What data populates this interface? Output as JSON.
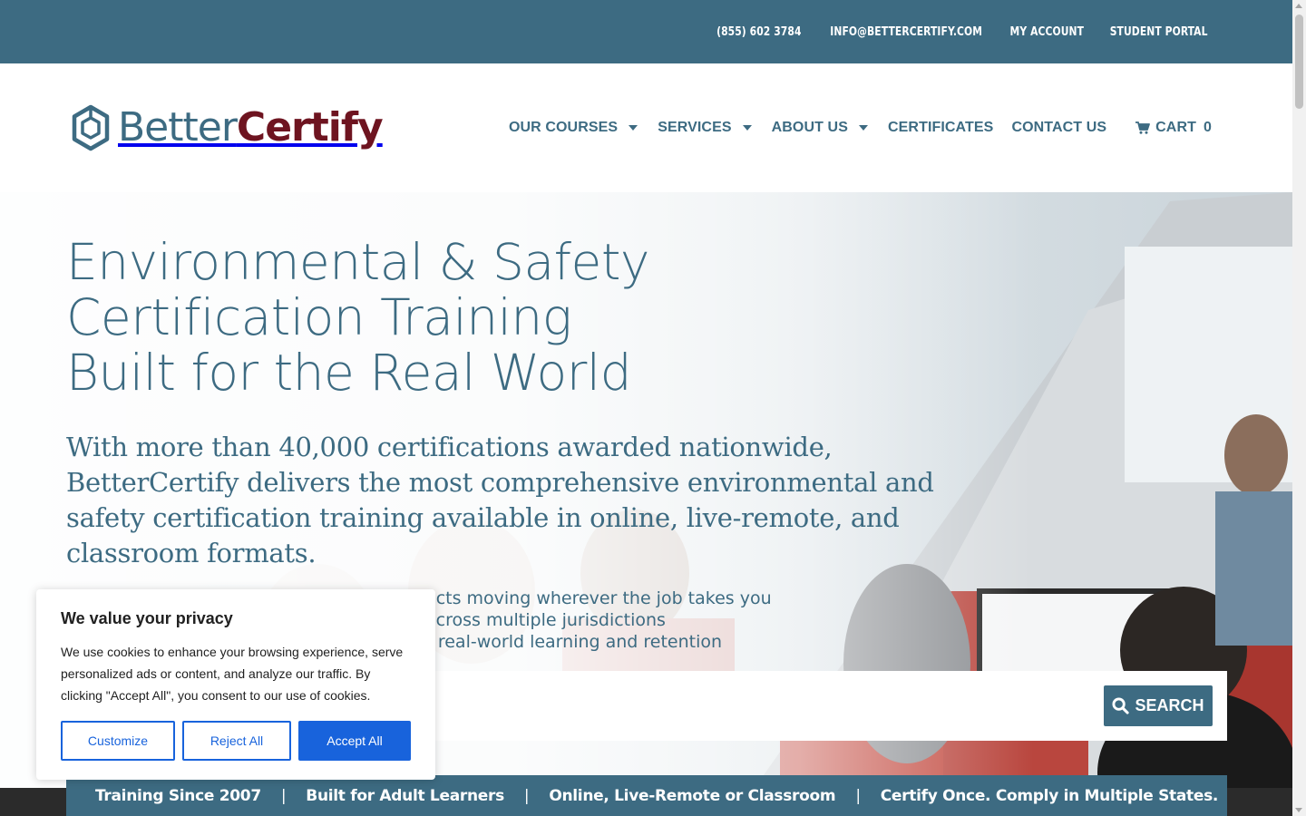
{
  "topbar": {
    "phone": "(855) 602 3784",
    "email": "INFO@BETTERCERTIFY.COM",
    "account": "MY ACCOUNT",
    "portal": "STUDENT PORTAL"
  },
  "brand": {
    "name_part1": "Better",
    "name_part2": "Certify",
    "logo_icon": "hexagon-logo-icon"
  },
  "nav": {
    "items": [
      {
        "label": "OUR COURSES",
        "has_dropdown": true
      },
      {
        "label": "SERVICES",
        "has_dropdown": true
      },
      {
        "label": "ABOUT US",
        "has_dropdown": true
      },
      {
        "label": "CERTIFICATES",
        "has_dropdown": false
      },
      {
        "label": "CONTACT US",
        "has_dropdown": false
      }
    ],
    "cart_label": "CART",
    "cart_count": "0",
    "cart_icon": "shopping-cart-icon"
  },
  "hero": {
    "title_lines": [
      "Environmental & Safety",
      "Certification Training",
      "Built for the Real World"
    ],
    "subtitle": "With more than 40,000 certifications awarded nationwide, BetterCertify delivers the most comprehensive environmental and safety certification training available in online, live-remote, and classroom formats.",
    "bullets": [
      "ects moving wherever the job takes you",
      "across multiple jurisdictions",
      "r real-world learning and retention"
    ]
  },
  "search": {
    "placeholder": "",
    "button_label": "SEARCH",
    "icon": "search-icon"
  },
  "features": {
    "items": [
      "Training Since 2007",
      "Built for Adult Learners",
      "Online, Live-Remote or Classroom",
      "Certify Once. Comply in Multiple States."
    ],
    "separator": "|"
  },
  "cookie": {
    "title": "We value your privacy",
    "text": "We use cookies to enhance your browsing experience, serve personalized ads or content, and analyze our traffic. By clicking \"Accept All\", you consent to our use of cookies.",
    "customize": "Customize",
    "reject": "Reject All",
    "accept": "Accept All"
  },
  "colors": {
    "brand_teal": "#3d6b82",
    "brand_maroon": "#6e1420",
    "cookie_blue": "#1863dc"
  }
}
